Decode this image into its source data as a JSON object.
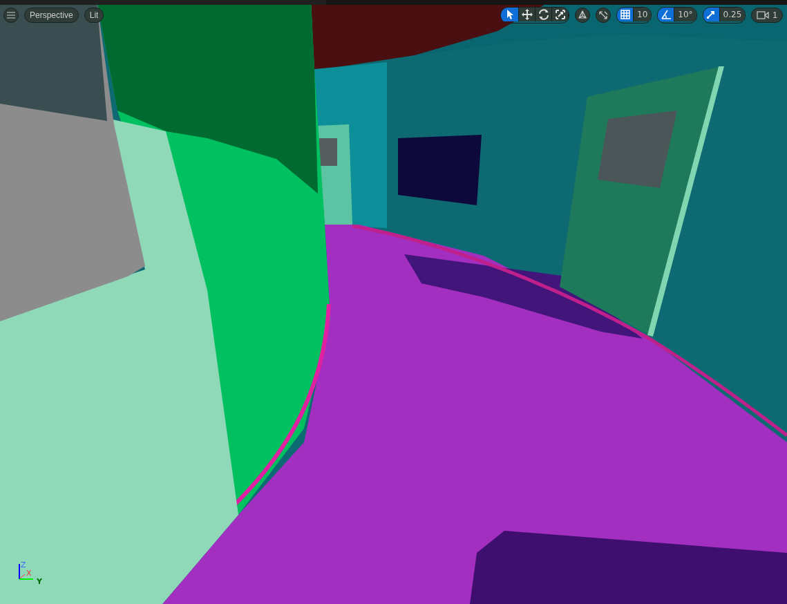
{
  "viewport": {
    "view_mode": "Perspective",
    "lighting": "Lit"
  },
  "transform_tools": [
    {
      "kind": "select",
      "selected": true
    },
    {
      "kind": "move",
      "selected": false
    },
    {
      "kind": "rotate",
      "selected": false
    },
    {
      "kind": "scale",
      "selected": false
    }
  ],
  "snapping": [
    {
      "kind": "grid",
      "on": true,
      "value": "10"
    },
    {
      "kind": "angle",
      "on": true,
      "value": "10°"
    },
    {
      "kind": "scale",
      "on": true,
      "value": "0.25"
    }
  ],
  "camera_speed": "1",
  "axis_labels": {
    "z": "Z",
    "x": "X",
    "y": "Y"
  }
}
